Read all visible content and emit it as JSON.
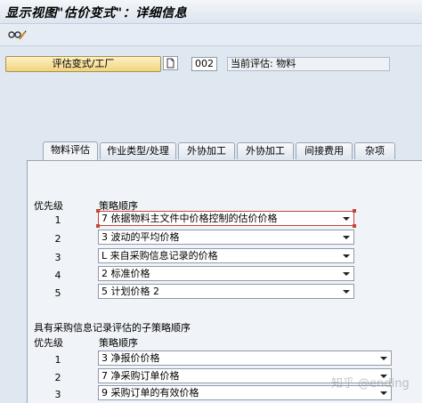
{
  "window": {
    "title": "显示视图\"估价变式\"：详细信息"
  },
  "header": {
    "variant_button_label": "评估变式/工厂",
    "variant_code": "002",
    "current_eval_label": "当前评估: 物料"
  },
  "tabs": [
    {
      "label": "物料评估",
      "active": true
    },
    {
      "label": "作业类型/处理",
      "active": false
    },
    {
      "label": "外协加工",
      "active": false
    },
    {
      "label": "外协加工",
      "active": false
    },
    {
      "label": "间接费用",
      "active": false
    },
    {
      "label": "杂项",
      "active": false
    }
  ],
  "strategy": {
    "priority_header": "优先级",
    "sequence_header": "策略顺序",
    "rows": [
      {
        "priority": "1",
        "value": "7 依据物料主文件中价格控制的估价价格"
      },
      {
        "priority": "2",
        "value": "3 波动的平均价格"
      },
      {
        "priority": "3",
        "value": "L 来自采购信息记录的价格"
      },
      {
        "priority": "4",
        "value": "2 标准价格"
      },
      {
        "priority": "5",
        "value": "5 计划价格 2"
      }
    ]
  },
  "sub_strategy": {
    "section_title": "具有采购信息记录评估的子策略顺序",
    "priority_header": "优先级",
    "sequence_header": "策略顺序",
    "rows": [
      {
        "priority": "1",
        "value": "3 净报价价格"
      },
      {
        "priority": "2",
        "value": "7 净采购订单价格"
      },
      {
        "priority": "3",
        "value": "9 采购订单的有效价格"
      }
    ]
  },
  "watermark": "知乎 @ending"
}
